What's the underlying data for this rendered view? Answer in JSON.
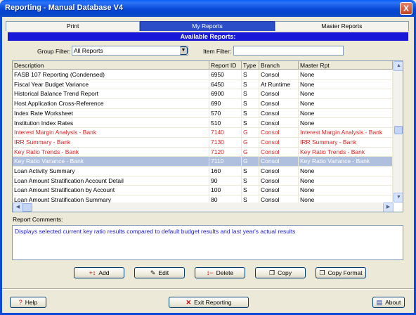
{
  "window": {
    "title": "Reporting - Manual Database V4",
    "close_label": "X"
  },
  "tabs": [
    {
      "label": "Print"
    },
    {
      "label": "My Reports"
    },
    {
      "label": "Master Reports"
    }
  ],
  "banner": "Available Reports:",
  "filters": {
    "group_label": "Group Filter:",
    "group_value": "All Reports",
    "item_label": "Item Filter:",
    "item_value": ""
  },
  "grid": {
    "columns": [
      "Description",
      "Report ID",
      "Type",
      "Branch",
      "Master Rpt"
    ],
    "rows": [
      {
        "desc": "FASB 107 Reporting (Condensed)",
        "id": "6950",
        "type": "S",
        "branch": "Consol",
        "master": "None",
        "style": "normal"
      },
      {
        "desc": "Fiscal Year Budget Variance",
        "id": "6450",
        "type": "S",
        "branch": "At Runtime",
        "master": "None",
        "style": "normal"
      },
      {
        "desc": "Historical Balance Trend Report",
        "id": "6900",
        "type": "S",
        "branch": "Consol",
        "master": "None",
        "style": "normal"
      },
      {
        "desc": "Host Application Cross-Reference",
        "id": "690",
        "type": "S",
        "branch": "Consol",
        "master": "None",
        "style": "normal"
      },
      {
        "desc": "Index Rate Worksheet",
        "id": "570",
        "type": "S",
        "branch": "Consol",
        "master": "None",
        "style": "normal"
      },
      {
        "desc": "Institution Index Rates",
        "id": "510",
        "type": "S",
        "branch": "Consol",
        "master": "None",
        "style": "normal"
      },
      {
        "desc": "Interest Margin Analysis - Bank",
        "id": "7140",
        "type": "G",
        "branch": "Consol",
        "master": "Interest Margin Analysis - Bank",
        "style": "red"
      },
      {
        "desc": "IRR Summary - Bank",
        "id": "7130",
        "type": "G",
        "branch": "Consol",
        "master": "IRR Summary - Bank",
        "style": "red"
      },
      {
        "desc": "Key Ratio Trends - Bank",
        "id": "7120",
        "type": "G",
        "branch": "Consol",
        "master": "Key Ratio Trends - Bank",
        "style": "red"
      },
      {
        "desc": "Key Ratio Variance - Bank",
        "id": "7110",
        "type": "G",
        "branch": "Consol",
        "master": "Key Ratio Variance - Bank",
        "style": "selected"
      },
      {
        "desc": "Loan Activity Summary",
        "id": "160",
        "type": "S",
        "branch": "Consol",
        "master": "None",
        "style": "normal"
      },
      {
        "desc": "Loan Amount Stratification Account Detail",
        "id": "90",
        "type": "S",
        "branch": "Consol",
        "master": "None",
        "style": "normal"
      },
      {
        "desc": "Loan Amount Stratification by Account",
        "id": "100",
        "type": "S",
        "branch": "Consol",
        "master": "None",
        "style": "normal"
      },
      {
        "desc": "Loan Amount Stratification Summary",
        "id": "80",
        "type": "S",
        "branch": "Consol",
        "master": "None",
        "style": "normal"
      }
    ]
  },
  "comments": {
    "label": "Report Comments:",
    "text": "Displays selected current key ratio results compared to default budget results and last year's actual results"
  },
  "actions": {
    "add": "Add",
    "edit": "Edit",
    "delete": "Delete",
    "copy": "Copy",
    "copy_format": "Copy Format"
  },
  "footer": {
    "help": "Help",
    "exit": "Exit Reporting",
    "about": "About"
  },
  "colors": {
    "selected_row": "#afc0de",
    "red_text": "#e02020",
    "banner": "#1818d8",
    "comment_text": "#1a1ad0"
  },
  "icons": [
    "close-icon",
    "dropdown-arrow-icon",
    "scroll-up-icon",
    "scroll-down-icon",
    "scroll-left-icon",
    "scroll-right-icon",
    "add-icon",
    "edit-icon",
    "delete-icon",
    "copy-icon",
    "copy-format-icon",
    "help-icon",
    "exit-icon",
    "about-icon"
  ]
}
